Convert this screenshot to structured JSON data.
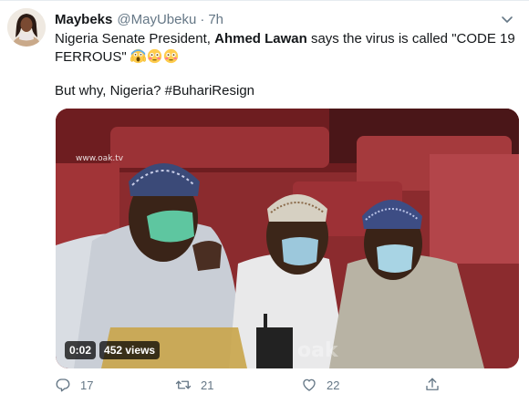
{
  "tweet": {
    "display_name": "Maybeks",
    "handle": "@MayUbeku",
    "separator": "·",
    "time": "7h",
    "text_part1": "Nigeria Senate President, ",
    "text_bold": "Ahmed Lawan",
    "text_part2": " says the virus is called \"CODE 19 FERROUS\" ",
    "text_line2_prefix": "But why, Nigeria? ",
    "hashtag": "#BuhariResign",
    "emojis": [
      "screaming-face-emoji",
      "flushed-face-emoji",
      "flushed-face-emoji"
    ]
  },
  "media": {
    "watermark": "www.oak.tv",
    "video_time": "0:02",
    "video_views": "452 views"
  },
  "actions": {
    "reply_count": "17",
    "retweet_count": "21",
    "like_count": "22"
  },
  "colors": {
    "link": "#1b95e0",
    "secondary_text": "#657786"
  }
}
